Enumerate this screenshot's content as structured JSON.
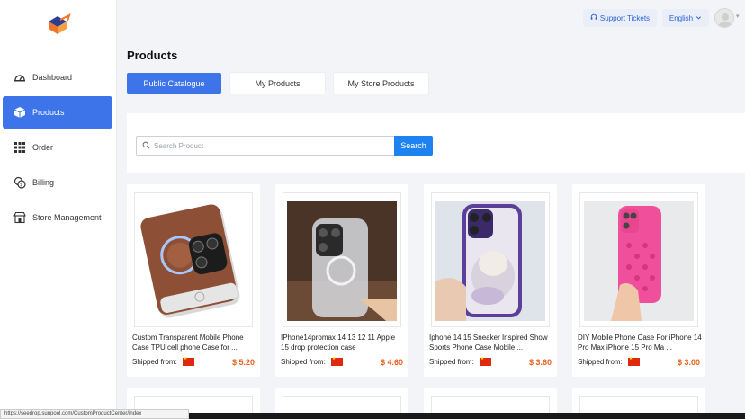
{
  "sidebar": {
    "items": [
      {
        "label": "Dashboard",
        "icon": "dashboard-icon"
      },
      {
        "label": "Products",
        "icon": "box-icon",
        "active": true
      },
      {
        "label": "Order",
        "icon": "grid-icon"
      },
      {
        "label": "Billing",
        "icon": "coins-icon"
      },
      {
        "label": "Store Management",
        "icon": "store-icon"
      }
    ]
  },
  "topbar": {
    "support_label": "Support Tickets",
    "language_label": "English"
  },
  "page": {
    "title": "Products",
    "tabs": [
      {
        "label": "Public Catalogue",
        "active": true
      },
      {
        "label": "My Products"
      },
      {
        "label": "My Store Products"
      }
    ]
  },
  "search": {
    "placeholder": "Search Product",
    "button_label": "Search"
  },
  "products": [
    {
      "name": "Custom Transparent Mobile Phone Case TPU cell phone Case for ...",
      "shipped_from_label": "Shipped from:",
      "price": "$ 5.20"
    },
    {
      "name": "IPhone14promax 14 13 12 11 Apple 15 drop protection case",
      "shipped_from_label": "Shipped from:",
      "price": "$ 4.60"
    },
    {
      "name": "Iphone 14 15 Sneaker Inspired Show Sports Phone Case Mobile ...",
      "shipped_from_label": "Shipped from:",
      "price": "$ 3.60"
    },
    {
      "name": "DIY Mobile Phone Case For iPhone 14 Pro Max iPhone 15 Pro Ma ...",
      "shipped_from_label": "Shipped from:",
      "price": "$ 3.00"
    }
  ],
  "status_url": "https://seedrop.sunpool.com/CustomProductCenter/index",
  "colors": {
    "accent": "#3d74e9",
    "search_button": "#1e82f0",
    "price": "#e8601c"
  }
}
